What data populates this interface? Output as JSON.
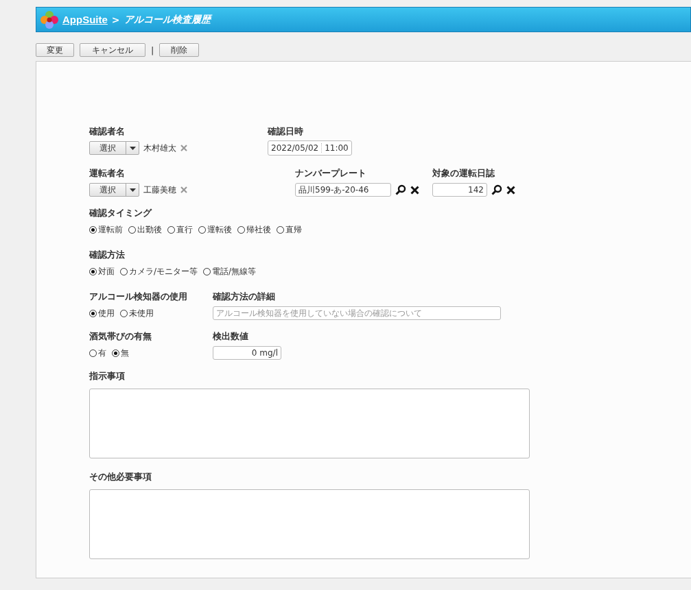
{
  "header": {
    "app": "AppSuite",
    "separator": ">",
    "title": "アルコール検査履歴"
  },
  "toolbar": {
    "buttons": [
      "変更",
      "キャンセル"
    ],
    "separator": "|",
    "delete_button": "削除"
  },
  "checker": {
    "label": "確認者名",
    "select_button": "選択",
    "name": "木村雄太"
  },
  "checked_at": {
    "label": "確認日時",
    "date": "2022/05/02",
    "time": "11:00"
  },
  "driver": {
    "label": "運転者名",
    "select_button": "選択",
    "name": "工藤美穂"
  },
  "plate": {
    "label": "ナンバープレート",
    "value": "品川599-あ-20-46"
  },
  "log": {
    "label": "対象の運転日誌",
    "value": "142"
  },
  "timing": {
    "label": "確認タイミング",
    "options": [
      {
        "label": "運転前",
        "selected": true
      },
      {
        "label": "出勤後",
        "selected": false
      },
      {
        "label": "直行",
        "selected": false
      },
      {
        "label": "運転後",
        "selected": false
      },
      {
        "label": "帰社後",
        "selected": false
      },
      {
        "label": "直帰",
        "selected": false
      }
    ]
  },
  "method": {
    "label": "確認方法",
    "options": [
      {
        "label": "対面",
        "selected": true
      },
      {
        "label": "カメラ/モニター等",
        "selected": false
      },
      {
        "label": "電話/無線等",
        "selected": false
      }
    ]
  },
  "detector": {
    "label": "アルコール検知器の使用",
    "options": [
      {
        "label": "使用",
        "selected": true
      },
      {
        "label": "未使用",
        "selected": false
      }
    ]
  },
  "method_detail": {
    "label": "確認方法の詳細",
    "placeholder": "アルコール検知器を使用していない場合の確認について"
  },
  "intoxication": {
    "label": "酒気帯びの有無",
    "options": [
      {
        "label": "有",
        "selected": false
      },
      {
        "label": "無",
        "selected": true
      }
    ]
  },
  "reading": {
    "label": "検出数値",
    "value": "0 mg/l"
  },
  "instructions": {
    "label": "指示事項"
  },
  "other": {
    "label": "その他必要事項"
  }
}
